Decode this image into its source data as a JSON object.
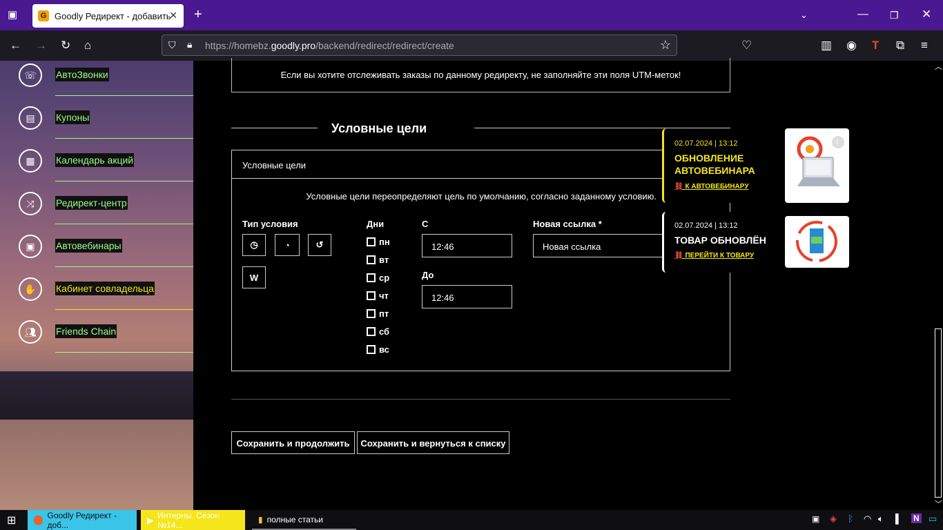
{
  "browser": {
    "tab_title": "Goodly Редирект - добавить",
    "url_prefix": "https://homebz.",
    "url_domain": "goodly.pro",
    "url_path": "/backend/redirect/redirect/create"
  },
  "sidebar": {
    "items": [
      {
        "label": "АвтоЗвонки",
        "icon": "phone-icon"
      },
      {
        "label": "Купоны",
        "icon": "coupon-icon"
      },
      {
        "label": "Календарь акций",
        "icon": "calendar-icon"
      },
      {
        "label": "Редирект-центр",
        "icon": "shuffle-icon"
      },
      {
        "label": "Автовебинары",
        "icon": "webinar-icon"
      },
      {
        "label": "Кабинет совладельца",
        "icon": "handshake-icon"
      },
      {
        "label": "Friends Chain",
        "icon": "people-icon"
      }
    ]
  },
  "main": {
    "utm_notice": "Если вы хотите отслеживать заказы по данному редиректу, не заполняйте эти поля UTM-меток!",
    "section_title": "Условные цели",
    "panel_title": "Условные цели",
    "panel_desc": "Условные цели переопределяют цель по умолчанию, согласно заданному условию.",
    "type_label": "Тип условия",
    "type_w": "W",
    "days_label": "Дни",
    "days": [
      "пн",
      "вт",
      "ср",
      "чт",
      "пт",
      "сб",
      "вс"
    ],
    "from_label": "С",
    "from_value": "12:46",
    "to_label": "До",
    "to_value": "12:46",
    "new_link_label": "Новая ссылка *",
    "new_link_placeholder": "Новая ссылка",
    "save_continue": "Сохранить и продолжить",
    "save_return": "Сохранить и вернуться к списку"
  },
  "notifications": [
    {
      "date": "02.07.2024 | 13:12",
      "title": "ОБНОВЛЕНИЕ АВТОВЕБИНАРА",
      "link": "К АВТОВЕБИНАРУ"
    },
    {
      "date": "02.07.2024 | 13:12",
      "title": "ТОВАР ОБНОВЛЁН",
      "link": "ПЕРЕЙТИ К ТОВАРУ"
    }
  ],
  "taskbar": {
    "items": [
      "Goodly Редирект - доб...",
      "Интерны. Сезон №14...",
      "полные статьи"
    ]
  },
  "colors": {
    "accent_green": "#9dff8a",
    "accent_yellow": "#f4e61a",
    "tab_bar": "#4a1891"
  }
}
